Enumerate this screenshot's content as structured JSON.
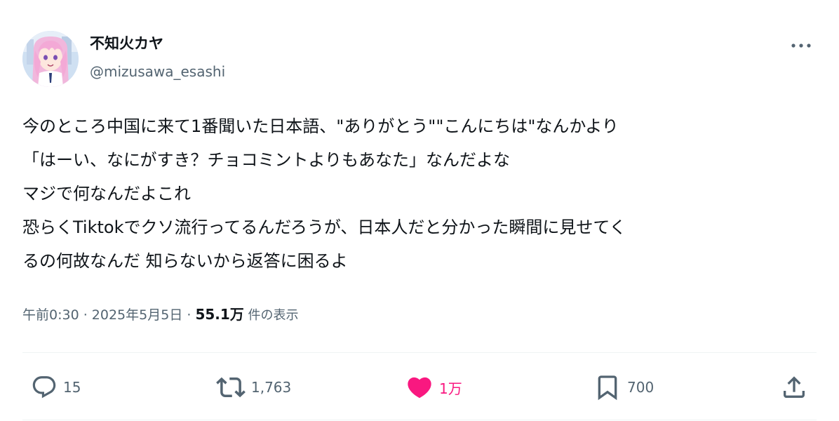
{
  "author": {
    "display_name": "不知火カヤ",
    "handle": "@mizusawa_esashi"
  },
  "post": {
    "lines": [
      "今のところ中国に来て1番聞いた日本語、\"ありがとう\"\"こんにちは\"なんかより",
      "「はーい、なにがすき？チョコミントよりもあなた」なんだよな",
      "マジで何なんだよこれ",
      "恐らくTiktokでクソ流行ってるんだろうが、日本人だと分かった瞬間に見せてく",
      "るの何故なんだ 知らないから返答に困るよ"
    ]
  },
  "meta": {
    "time": "午前0:30",
    "separator": " · ",
    "date": "2025年5月5日",
    "views_count": "55.1万",
    "views_suffix": " 件の表示"
  },
  "actions": {
    "replies": "15",
    "reposts": "1,763",
    "likes": "1万",
    "bookmarks": "700"
  },
  "colors": {
    "text": "#0f1419",
    "secondary": "#536471",
    "like": "#f91880",
    "divider": "#eff3f4"
  },
  "icons": [
    "more-icon",
    "reply-icon",
    "repost-icon",
    "like-icon",
    "bookmark-icon",
    "share-icon"
  ]
}
